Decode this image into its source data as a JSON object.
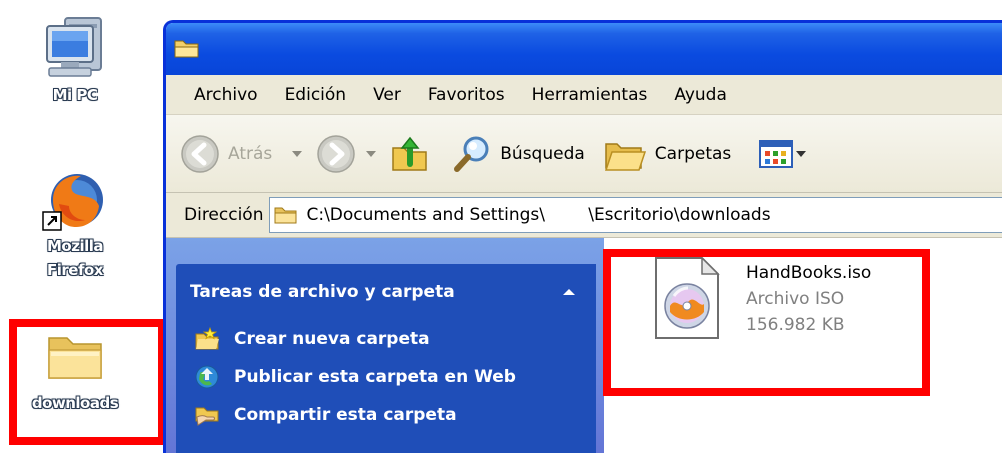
{
  "desktop": {
    "icons": [
      {
        "label": "Mi PC",
        "icon": "my-computer-icon"
      },
      {
        "label": "Mozilla Firefox",
        "icon": "firefox-icon"
      },
      {
        "label": "downloads",
        "icon": "folder-icon"
      }
    ]
  },
  "window": {
    "title_icon": "folder-icon",
    "menu": [
      "Archivo",
      "Edición",
      "Ver",
      "Favoritos",
      "Herramientas",
      "Ayuda"
    ],
    "toolbar": {
      "back_label": "Atrás",
      "search_label": "Búsqueda",
      "folders_label": "Carpetas"
    },
    "address": {
      "label": "Dirección",
      "path": "C:\\Documents and Settings\\        \\Escritorio\\downloads"
    },
    "taskpane": {
      "header": "Tareas de archivo y carpeta",
      "items": [
        {
          "label": "Crear nueva carpeta",
          "icon": "new-folder-icon"
        },
        {
          "label": "Publicar esta carpeta en Web",
          "icon": "publish-web-icon"
        },
        {
          "label": "Compartir esta carpeta",
          "icon": "share-folder-icon"
        }
      ]
    },
    "files": [
      {
        "name": "HandBooks.iso",
        "type": "Archivo ISO",
        "size": "156.982 KB",
        "icon": "iso-file-icon"
      }
    ]
  },
  "colors": {
    "annotation": "#ff0000",
    "taskpane_bg": "#1f4eb8",
    "titlebar": "#0a4be0"
  }
}
